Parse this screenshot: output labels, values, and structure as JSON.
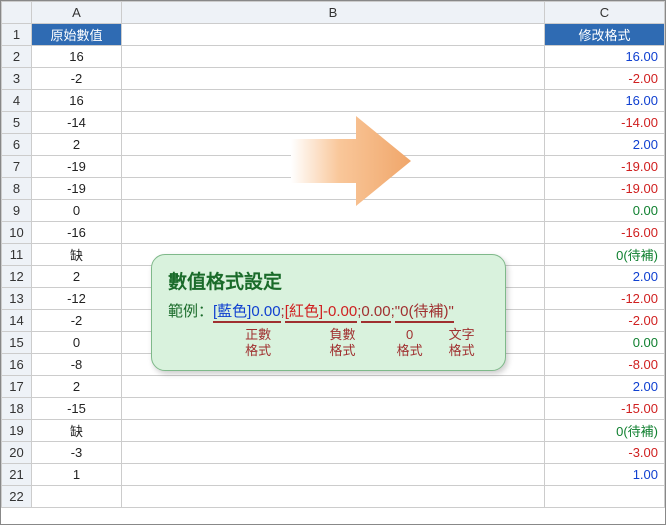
{
  "columns": {
    "A": "A",
    "B": "B",
    "C": "C"
  },
  "headerA": "原始數值",
  "headerC": "修改格式",
  "rows": [
    {
      "n": 1
    },
    {
      "n": 2,
      "a": "16",
      "c": "16.00",
      "cls": "c-pos"
    },
    {
      "n": 3,
      "a": "-2",
      "c": "-2.00",
      "cls": "c-neg"
    },
    {
      "n": 4,
      "a": "16",
      "c": "16.00",
      "cls": "c-pos"
    },
    {
      "n": 5,
      "a": "-14",
      "c": "-14.00",
      "cls": "c-neg"
    },
    {
      "n": 6,
      "a": "2",
      "c": "2.00",
      "cls": "c-pos"
    },
    {
      "n": 7,
      "a": "-19",
      "c": "-19.00",
      "cls": "c-neg"
    },
    {
      "n": 8,
      "a": "-19",
      "c": "-19.00",
      "cls": "c-neg"
    },
    {
      "n": 9,
      "a": "0",
      "c": "0.00",
      "cls": "c-zero"
    },
    {
      "n": 10,
      "a": "-16",
      "c": "-16.00",
      "cls": "c-neg"
    },
    {
      "n": 11,
      "a": "缺",
      "c": "0(待補)",
      "cls": "c-text"
    },
    {
      "n": 12,
      "a": "2",
      "c": "2.00",
      "cls": "c-pos"
    },
    {
      "n": 13,
      "a": "-12",
      "c": "-12.00",
      "cls": "c-neg"
    },
    {
      "n": 14,
      "a": "-2",
      "c": "-2.00",
      "cls": "c-neg"
    },
    {
      "n": 15,
      "a": "0",
      "c": "0.00",
      "cls": "c-zero"
    },
    {
      "n": 16,
      "a": "-8",
      "c": "-8.00",
      "cls": "c-neg"
    },
    {
      "n": 17,
      "a": "2",
      "c": "2.00",
      "cls": "c-pos"
    },
    {
      "n": 18,
      "a": "-15",
      "c": "-15.00",
      "cls": "c-neg"
    },
    {
      "n": 19,
      "a": "缺",
      "c": "0(待補)",
      "cls": "c-text"
    },
    {
      "n": 20,
      "a": "-3",
      "c": "-3.00",
      "cls": "c-neg"
    },
    {
      "n": 21,
      "a": "1",
      "c": "1.00",
      "cls": "c-pos"
    },
    {
      "n": 22
    }
  ],
  "info": {
    "title": "數值格式設定",
    "exLabel": "範例：",
    "segPos": "[藍色]0.00",
    "segNeg": "[紅色]-0.00",
    "segZero": "0.00",
    "segText": "\"0(待補)\"",
    "sep": ";",
    "legPos1": "正數",
    "legPos2": "格式",
    "legNeg1": "負數",
    "legNeg2": "格式",
    "legZero1": "0",
    "legZero2": "格式",
    "legText1": "文字",
    "legText2": "格式"
  }
}
